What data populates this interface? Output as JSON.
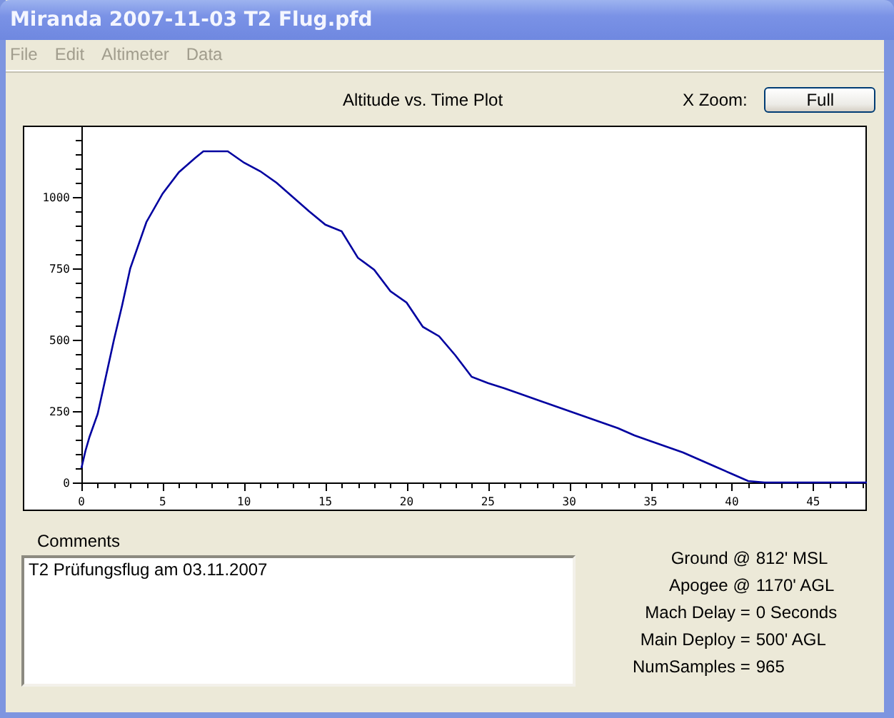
{
  "window": {
    "title": "Miranda 2007-11-03 T2 Flug.pfd"
  },
  "menu": [
    "File",
    "Edit",
    "Altimeter",
    "Data"
  ],
  "plot": {
    "title": "Altitude vs. Time Plot",
    "zoom_label": "X Zoom:",
    "zoom_button": "Full",
    "chart_data": {
      "type": "line",
      "xlim": [
        -3.6,
        48.3
      ],
      "ylim": [
        -100,
        1250
      ],
      "xticks": [
        0,
        5,
        10,
        15,
        20,
        25,
        30,
        35,
        40,
        45
      ],
      "yticks": [
        0,
        250,
        500,
        750,
        1000
      ],
      "x": [
        0,
        0.25,
        0.5,
        1,
        1.5,
        2,
        2.5,
        3,
        4,
        5,
        6,
        7,
        7.5,
        9,
        10,
        11,
        12,
        13,
        14,
        15,
        16,
        17,
        18,
        19,
        20,
        21,
        22,
        23,
        24,
        25,
        26,
        27,
        28,
        29,
        30,
        31,
        32,
        33,
        34,
        35,
        36,
        37,
        38,
        39,
        40,
        41,
        42,
        48.3
      ],
      "series": [
        {
          "color": "#0000a0",
          "values": [
            50,
            110,
            160,
            240,
            370,
            500,
            620,
            750,
            912,
            1012,
            1087,
            1137,
            1160,
            1160,
            1120,
            1090,
            1050,
            1000,
            950,
            903,
            880,
            787,
            745,
            670,
            630,
            545,
            512,
            445,
            370,
            348,
            330,
            310,
            290,
            270,
            250,
            230,
            210,
            190,
            165,
            145,
            125,
            105,
            80,
            55,
            30,
            5,
            0,
            0
          ]
        }
      ]
    }
  },
  "comments": {
    "label": "Comments",
    "value": "T2 Prüfungsflug am 03.11.2007"
  },
  "stats": [
    {
      "label": "Ground @",
      "value": "812' MSL"
    },
    {
      "label": "Apogee @",
      "value": "1170' AGL"
    },
    {
      "label": "Mach Delay =",
      "value": "0 Seconds"
    },
    {
      "label": "Main Deploy =",
      "value": "500' AGL"
    },
    {
      "label": "NumSamples =",
      "value": "965"
    }
  ]
}
